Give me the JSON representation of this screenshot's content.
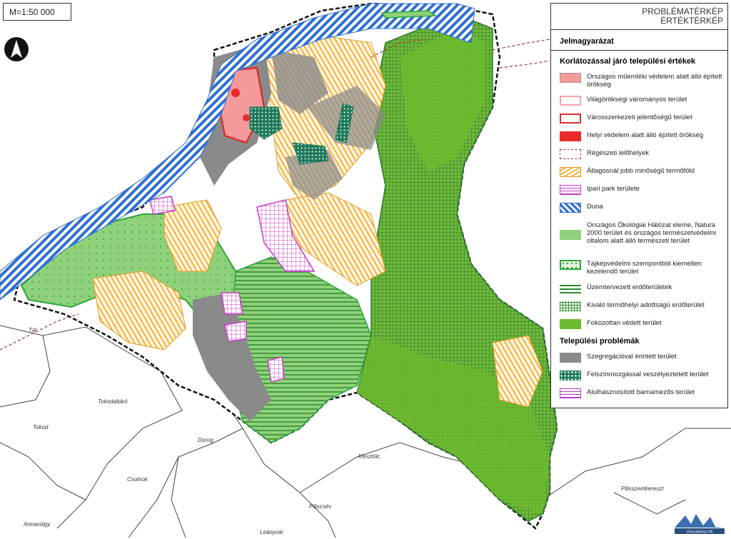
{
  "scale": "M=1:50 000",
  "title_lines": [
    "PROBLÉMATÉRKÉP",
    "ÉRTÉKTÉRKÉP"
  ],
  "legend": {
    "heading": "Jelmagyarázat",
    "section1_title": "Korlátozással járó települési értékek",
    "section1_items": [
      {
        "label": "Országos műemléki védelem alatt álló épített örökség",
        "symbol": "monument-fill"
      },
      {
        "label": "Világörökségi várományos terület",
        "symbol": "world-heritage-outline"
      },
      {
        "label": "Városszerkezeti jelentőségű terület",
        "symbol": "urban-structure-outline"
      },
      {
        "label": "Helyi védelem alatt álló épített örökség",
        "symbol": "local-protection-fill"
      },
      {
        "label": "Régészeti lelőhelyek",
        "symbol": "archaeology-dashed"
      },
      {
        "label": "Átlagosnál jobb minőségű termőföld",
        "symbol": "farmland-hatch"
      },
      {
        "label": "Ipari park területe",
        "symbol": "industrial-park-grid"
      },
      {
        "label": "Duna",
        "symbol": "danube-hatch"
      },
      {
        "label": "Országos Ökológiai Hálózat eleme, Natura 2000 terület és országos természetvédelmi oltalom alatt álló természeti terület",
        "symbol": "ecological-network-fill"
      },
      {
        "label": "Tájképvédelmi szempontból kiemelten kezelendő terület",
        "symbol": "landscape-protection-dots"
      },
      {
        "label": "Üzemtervezett erdőterületek",
        "symbol": "managed-forest-lines"
      },
      {
        "label": "Kiváló termőhelyi adottságú erdőterület",
        "symbol": "excellent-forest-grid"
      },
      {
        "label": "Fokozottan védett terület",
        "symbol": "strictly-protected-fill"
      }
    ],
    "section2_title": "Települési problémák",
    "section2_items": [
      {
        "label": "Szegregációval érintett terület",
        "symbol": "segregation-fill"
      },
      {
        "label": "Felszínmozgással veszélyeztetett terület",
        "symbol": "landslide-dots"
      },
      {
        "label": "Alulhasznosított barnamezős terület",
        "symbol": "brownfield-hatch"
      }
    ]
  },
  "places": [
    "Tát",
    "Tokodaltáró",
    "Tokod",
    "Dorog",
    "Csolnok",
    "Annavölgy",
    "Kesztölc",
    "Piliscsév",
    "Leányvár",
    "Pilisszentkereszt"
  ],
  "logo_text": "Városépítész Kft",
  "colors": {
    "monument": "#f49a9a",
    "world_heritage": "#f3a3a8",
    "urban_structure": "#d73030",
    "local_protection": "#e82b2b",
    "archaeology": "#a63a3a",
    "farmland": "#f4b03c",
    "industrial": "#c83cc8",
    "danube": "#2f6fcf",
    "ecological": "#8fd17a",
    "landscape": "#2aa63a",
    "managed_forest": "#2e8b2e",
    "excellent_forest": "#2f8f2f",
    "strict": "#6dbb2e",
    "segregation": "#8a8a8a",
    "landslide": "#1e7a5a",
    "brownfield": "#b53cc8"
  }
}
